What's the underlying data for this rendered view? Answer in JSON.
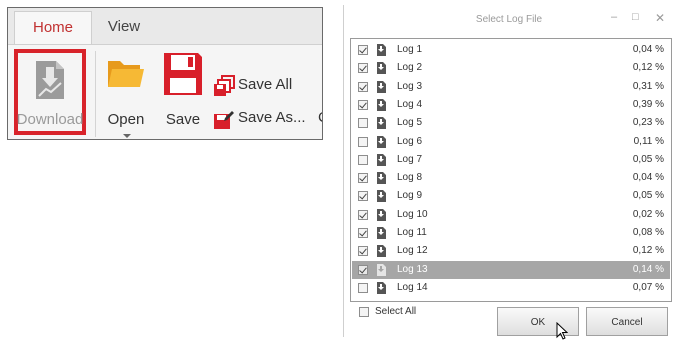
{
  "ribbon": {
    "tabs": {
      "home": "Home",
      "view": "View"
    },
    "download_label": "Download",
    "open_label": "Open",
    "save_label": "Save",
    "save_all_label": "Save All",
    "save_as_label": "Save As...",
    "clipped_label": "C",
    "icons": {
      "download": "download-icon",
      "open": "folder-open-icon",
      "save": "floppy-disk-icon",
      "save_all": "save-all-icon",
      "save_as": "save-as-icon"
    },
    "colors": {
      "accent": "#c13131",
      "highlight_border": "#d8232a"
    }
  },
  "dialog": {
    "title": "Select Log File",
    "window_controls": {
      "minimize": "–",
      "maximize": "□",
      "close": "✕"
    },
    "logs": [
      {
        "name": "Log 1",
        "percent": "0,04 %",
        "checked": true,
        "selected": false
      },
      {
        "name": "Log 2",
        "percent": "0,12 %",
        "checked": true,
        "selected": false
      },
      {
        "name": "Log 3",
        "percent": "0,31 %",
        "checked": true,
        "selected": false
      },
      {
        "name": "Log 4",
        "percent": "0,39 %",
        "checked": true,
        "selected": false
      },
      {
        "name": "Log 5",
        "percent": "0,23 %",
        "checked": false,
        "selected": false
      },
      {
        "name": "Log 6",
        "percent": "0,11 %",
        "checked": false,
        "selected": false
      },
      {
        "name": "Log 7",
        "percent": "0,05 %",
        "checked": false,
        "selected": false
      },
      {
        "name": "Log 8",
        "percent": "0,04 %",
        "checked": true,
        "selected": false
      },
      {
        "name": "Log 9",
        "percent": "0,05 %",
        "checked": true,
        "selected": false
      },
      {
        "name": "Log 10",
        "percent": "0,02 %",
        "checked": true,
        "selected": false
      },
      {
        "name": "Log 11",
        "percent": "0,08 %",
        "checked": true,
        "selected": false
      },
      {
        "name": "Log 12",
        "percent": "0,12 %",
        "checked": true,
        "selected": false
      },
      {
        "name": "Log 13",
        "percent": "0,14 %",
        "checked": true,
        "selected": true
      },
      {
        "name": "Log 14",
        "percent": "0,07 %",
        "checked": false,
        "selected": false
      }
    ],
    "select_all_label": "Select All",
    "select_all_checked": false,
    "ok_label": "OK",
    "cancel_label": "Cancel",
    "row_icon": "log-file-icon",
    "colors": {
      "selected_row": "#a6a6a6"
    }
  }
}
